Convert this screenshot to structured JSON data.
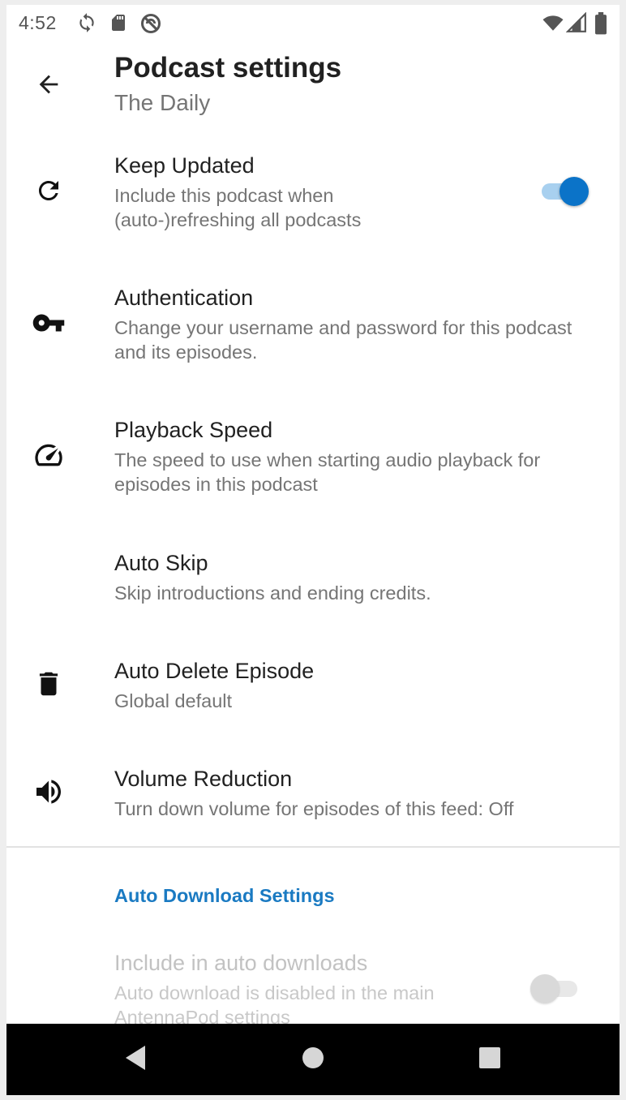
{
  "status_bar": {
    "time": "4:52",
    "icons_left": [
      "sync-icon",
      "sd-card-icon",
      "do-not-disturb-icon"
    ],
    "icons_right": [
      "wifi-icon",
      "cell-signal-icon",
      "battery-icon"
    ]
  },
  "toolbar": {
    "title": "Podcast settings",
    "subtitle": "The Daily",
    "back_icon": "arrow-back-icon"
  },
  "preferences": [
    {
      "icon": "refresh-icon",
      "title": "Keep Updated",
      "summary": "Include this podcast when (auto-)refreshing all podcasts",
      "switch": true,
      "switch_on": true
    },
    {
      "icon": "key-icon",
      "title": "Authentication",
      "summary": "Change your username and password for this podcast and its episodes."
    },
    {
      "icon": "speedometer-icon",
      "title": "Playback Speed",
      "summary": "The speed to use when starting audio playback for episodes in this podcast"
    },
    {
      "icon": "",
      "title": "Auto Skip",
      "summary": "Skip introductions and ending credits."
    },
    {
      "icon": "trash-icon",
      "title": "Auto Delete Episode",
      "summary": "Global default"
    },
    {
      "icon": "volume-icon",
      "title": "Volume Reduction",
      "summary": "Turn down volume for episodes of this feed: Off"
    }
  ],
  "auto_download": {
    "category_title": "Auto Download Settings",
    "title": "Include in auto downloads",
    "summary": "Auto download is disabled in the main AntennaPod settings",
    "switch_on": false,
    "enabled": false
  },
  "colors": {
    "accent": "#0b73c8",
    "accent_track": "#a8d0ef",
    "category_header": "#1a7ac2",
    "title_text": "#212121",
    "summary_text": "#757575"
  },
  "nav_bar": {
    "buttons": [
      "nav-back-icon",
      "nav-home-icon",
      "nav-recents-icon"
    ]
  }
}
